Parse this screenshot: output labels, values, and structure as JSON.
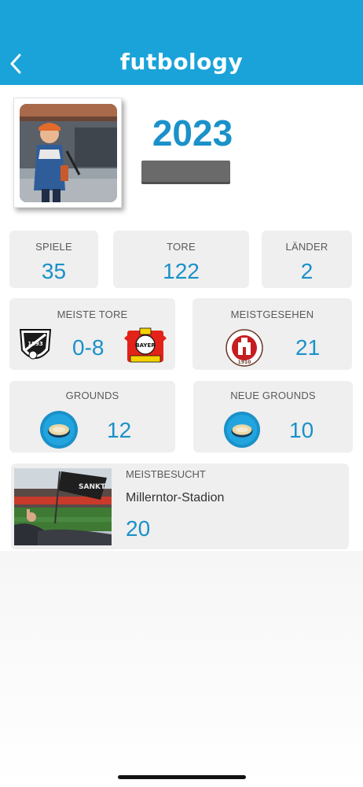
{
  "header": {
    "logo_text": "futbology",
    "background_color": "#1aa3d8"
  },
  "profile": {
    "year": "2023"
  },
  "stats": {
    "spiele": {
      "label": "SPIELE",
      "value": "35"
    },
    "tore": {
      "label": "TORE",
      "value": "122"
    },
    "laender": {
      "label": "LÄNDER",
      "value": "2"
    }
  },
  "meiste_tore": {
    "label": "MEISTE TORE",
    "score": "0-8",
    "home_crest_icon": "fc-teutonia-ottensen-crest",
    "away_crest_icon": "bayer-leverkusen-crest"
  },
  "meistgesehen": {
    "label": "MEISTGESEHEN",
    "value": "21",
    "crest_icon": "fc-st-pauli-crest"
  },
  "grounds": {
    "label": "GROUNDS",
    "value": "12",
    "icon": "stadium-icon"
  },
  "neue_grounds": {
    "label": "NEUE GROUNDS",
    "value": "10",
    "icon": "stadium-icon"
  },
  "meistbesucht": {
    "label": "MEISTBESUCHT",
    "stadium": "Millerntor-Stadion",
    "value": "20"
  },
  "accent_color": "#1a91c9"
}
